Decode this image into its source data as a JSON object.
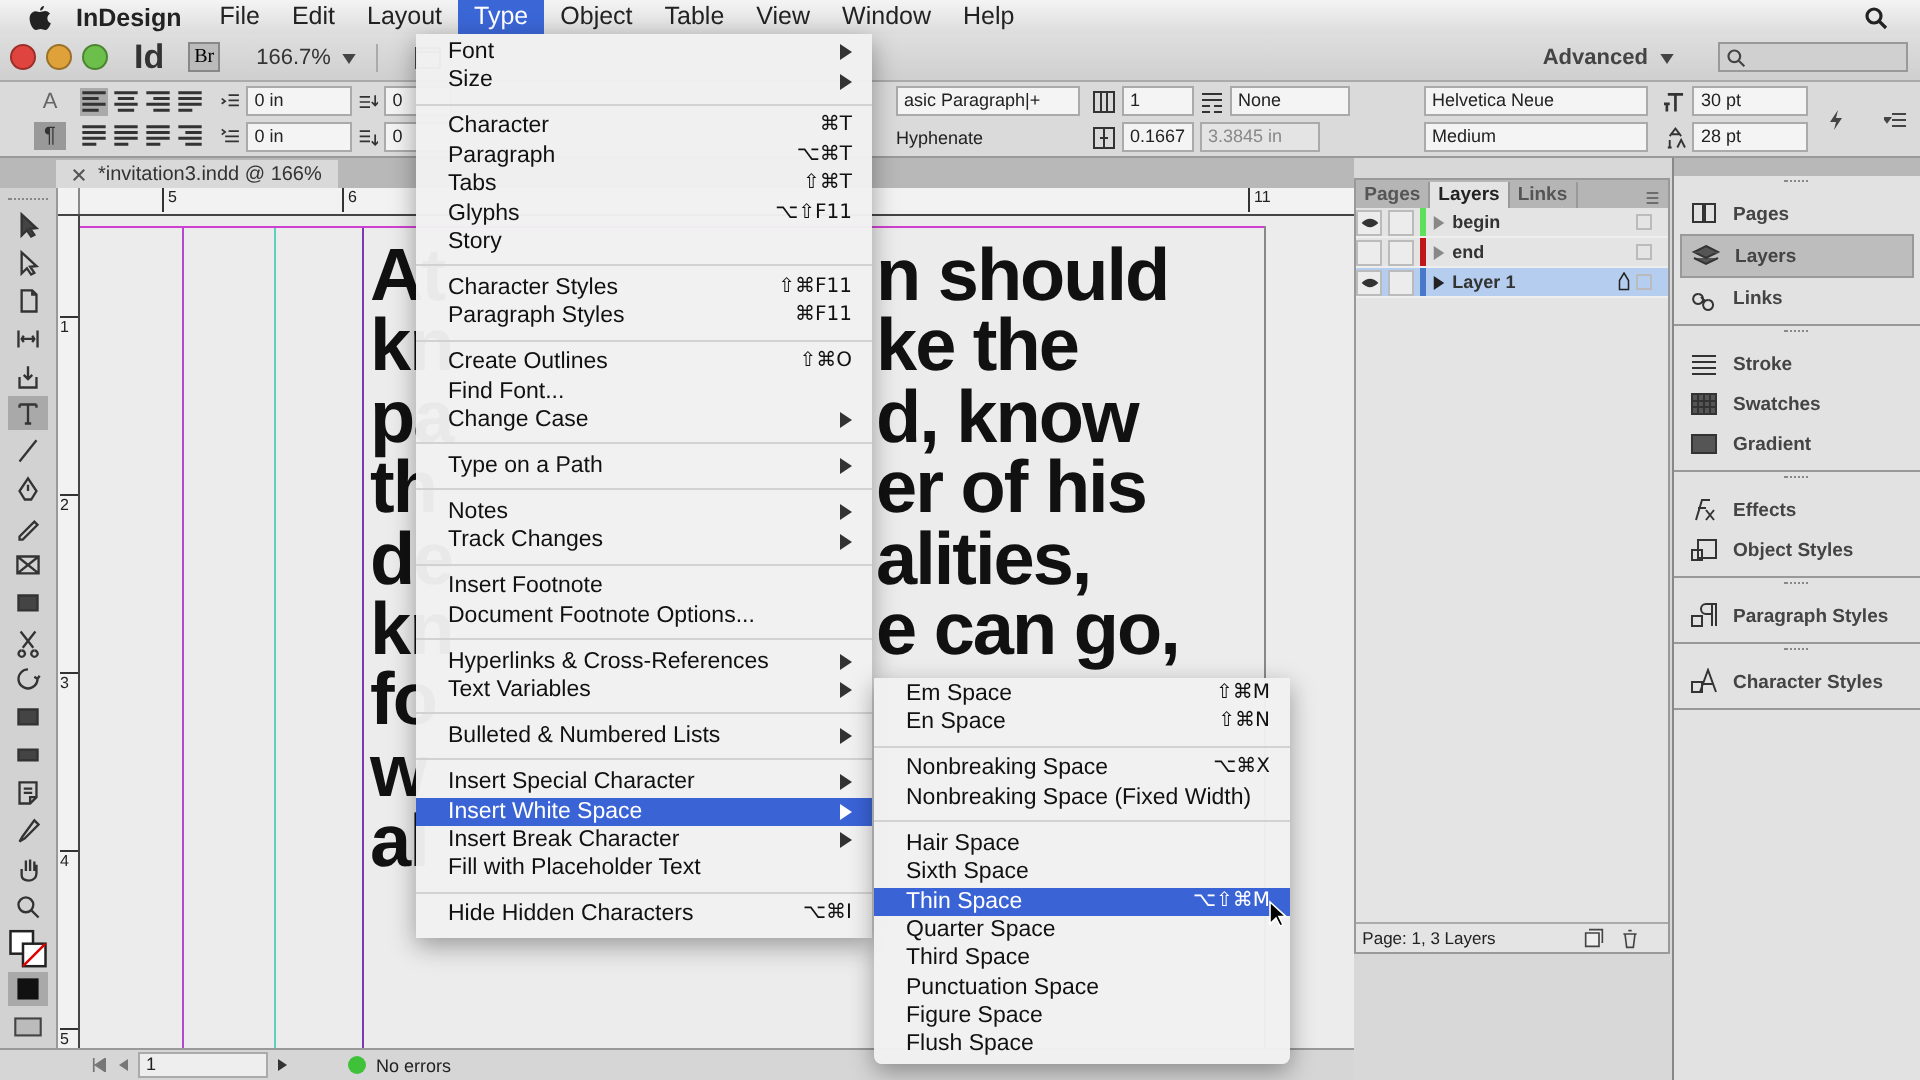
{
  "menu_bar": {
    "app": "InDesign",
    "items": [
      {
        "label": "File",
        "selected": false
      },
      {
        "label": "Edit",
        "selected": false
      },
      {
        "label": "Layout",
        "selected": false
      },
      {
        "label": "Type",
        "selected": true
      },
      {
        "label": "Object",
        "selected": false
      },
      {
        "label": "Table",
        "selected": false
      },
      {
        "label": "View",
        "selected": false
      },
      {
        "label": "Window",
        "selected": false
      },
      {
        "label": "Help",
        "selected": false
      }
    ]
  },
  "app_bar": {
    "logo": "Id",
    "bridge": "Br",
    "zoom": "166.7%",
    "workspace": "Advanced"
  },
  "control_panel": {
    "modes": [
      {
        "label": "A",
        "selected": false
      },
      {
        "label": "¶",
        "selected": true
      }
    ],
    "align": [
      {
        "kind": "left",
        "selected": true
      },
      {
        "kind": "center",
        "selected": false
      },
      {
        "kind": "right",
        "selected": false
      },
      {
        "kind": "justify",
        "selected": false
      },
      {
        "kind": "justify",
        "selected": false
      },
      {
        "kind": "justify",
        "selected": false
      },
      {
        "kind": "justify",
        "selected": false
      },
      {
        "kind": "right",
        "selected": false
      }
    ],
    "left_indent": "0 in",
    "first_indent": "0 in",
    "space_before": "0",
    "space_after": "0",
    "paragraph_style": "asic Paragraph|+",
    "hyphenate": "Hyphenate",
    "columns": "1",
    "span": "None",
    "gutter": "0.1667",
    "width": "3.3845 in",
    "font": "Helvetica Neue",
    "font_style": "Medium",
    "size": "30 pt",
    "leading": "28 pt"
  },
  "document_tab": {
    "title": "*invitation3.indd @ 166%"
  },
  "tools": [
    {
      "kind": "selection",
      "selected": false
    },
    {
      "kind": "direct",
      "selected": false
    },
    {
      "kind": "page",
      "selected": false
    },
    {
      "kind": "gap",
      "selected": false
    },
    {
      "kind": "collector",
      "selected": false
    },
    {
      "kind": "type",
      "selected": true
    },
    {
      "kind": "line",
      "selected": false
    },
    {
      "kind": "pen",
      "selected": false
    },
    {
      "kind": "pencil",
      "selected": false
    },
    {
      "kind": "frame",
      "selected": false
    },
    {
      "kind": "rect",
      "selected": false
    },
    {
      "kind": "scissors",
      "selected": false
    },
    {
      "kind": "transform",
      "selected": false
    },
    {
      "kind": "gradient",
      "selected": false
    },
    {
      "kind": "feather",
      "selected": false
    },
    {
      "kind": "note",
      "selected": false
    },
    {
      "kind": "eyedropper",
      "selected": false
    },
    {
      "kind": "hand",
      "selected": false
    },
    {
      "kind": "zoom",
      "selected": false
    }
  ],
  "rulers": {
    "horizontal": [
      "5",
      "6",
      "11"
    ],
    "vertical": [
      "1",
      "2",
      "3",
      "4",
      "5"
    ]
  },
  "document": {
    "lines": [
      {
        "left": "At",
        "right": "n should"
      },
      {
        "left": "kn",
        "right": "ke the"
      },
      {
        "left": "pa",
        "right": "d, know"
      },
      {
        "left": "th",
        "right": "er of his"
      },
      {
        "left": "de",
        "right": "alities,"
      },
      {
        "left": "kn",
        "right": "e can go,"
      },
      {
        "left": "fo"
      },
      {
        "left": "w"
      },
      {
        "left": "al"
      }
    ]
  },
  "status_bar": {
    "page": "1",
    "preflight": "No errors"
  },
  "type_menu": {
    "groups": [
      [
        {
          "label": "Font",
          "submenu": true,
          "selected": false
        },
        {
          "label": "Size",
          "submenu": true,
          "selected": false
        }
      ],
      [
        {
          "label": "Character",
          "shortcut": "⌘T",
          "selected": false
        },
        {
          "label": "Paragraph",
          "shortcut": "⌥⌘T",
          "selected": false
        },
        {
          "label": "Tabs",
          "shortcut": "⇧⌘T",
          "selected": false
        },
        {
          "label": "Glyphs",
          "shortcut": "⌥⇧F11",
          "selected": false
        },
        {
          "label": "Story",
          "selected": false
        }
      ],
      [
        {
          "label": "Character Styles",
          "shortcut": "⇧⌘F11",
          "selected": false
        },
        {
          "label": "Paragraph Styles",
          "shortcut": "⌘F11",
          "selected": false
        }
      ],
      [
        {
          "label": "Create Outlines",
          "shortcut": "⇧⌘O",
          "selected": false
        },
        {
          "label": "Find Font...",
          "selected": false
        },
        {
          "label": "Change Case",
          "submenu": true,
          "selected": false
        }
      ],
      [
        {
          "label": "Type on a Path",
          "submenu": true,
          "selected": false
        }
      ],
      [
        {
          "label": "Notes",
          "submenu": true,
          "selected": false
        },
        {
          "label": "Track Changes",
          "submenu": true,
          "selected": false
        }
      ],
      [
        {
          "label": "Insert Footnote",
          "selected": false
        },
        {
          "label": "Document Footnote Options...",
          "selected": false
        }
      ],
      [
        {
          "label": "Hyperlinks & Cross-References",
          "submenu": true,
          "selected": false
        },
        {
          "label": "Text Variables",
          "submenu": true,
          "selected": false
        }
      ],
      [
        {
          "label": "Bulleted & Numbered Lists",
          "submenu": true,
          "selected": false
        }
      ],
      [
        {
          "label": "Insert Special Character",
          "submenu": true,
          "selected": false
        },
        {
          "label": "Insert White Space",
          "submenu": true,
          "selected": true
        },
        {
          "label": "Insert Break Character",
          "submenu": true,
          "selected": false
        },
        {
          "label": "Fill with Placeholder Text",
          "selected": false
        }
      ],
      [
        {
          "label": "Hide Hidden Characters",
          "shortcut": "⌥⌘I",
          "selected": false
        }
      ]
    ]
  },
  "white_space_menu": {
    "groups": [
      [
        {
          "label": "Em Space",
          "shortcut": "⇧⌘M",
          "selected": false
        },
        {
          "label": "En Space",
          "shortcut": "⇧⌘N",
          "selected": false
        }
      ],
      [
        {
          "label": "Nonbreaking Space",
          "shortcut": "⌥⌘X",
          "selected": false
        },
        {
          "label": "Nonbreaking Space (Fixed Width)",
          "selected": false
        }
      ],
      [
        {
          "label": "Hair Space",
          "selected": false
        },
        {
          "label": "Sixth Space",
          "selected": false
        },
        {
          "label": "Thin Space",
          "shortcut": "⌥⇧⌘M",
          "selected": true
        },
        {
          "label": "Quarter Space",
          "selected": false
        },
        {
          "label": "Third Space",
          "selected": false
        },
        {
          "label": "Punctuation Space",
          "selected": false
        },
        {
          "label": "Figure Space",
          "selected": false
        },
        {
          "label": "Flush Space",
          "selected": false
        }
      ]
    ]
  },
  "layers_panel": {
    "tabs": [
      {
        "label": "Pages",
        "selected": false
      },
      {
        "label": "Layers",
        "selected": true
      },
      {
        "label": "Links",
        "selected": false
      }
    ],
    "layers": [
      {
        "name": "begin",
        "color": "#5fe05a",
        "visible": true,
        "selected": false
      },
      {
        "name": "end",
        "color": "#c0161b",
        "visible": false,
        "selected": false
      },
      {
        "name": "Layer 1",
        "color": "#4a78c8",
        "visible": true,
        "selected": true
      }
    ],
    "footer": "Page: 1, 3 Layers"
  },
  "dock": {
    "groups": [
      [
        {
          "label": "Pages",
          "kind": "pages",
          "selected": false
        },
        {
          "label": "Layers",
          "kind": "layers",
          "selected": true
        },
        {
          "label": "Links",
          "kind": "links",
          "selected": false
        }
      ],
      [
        {
          "label": "Stroke",
          "kind": "stroke",
          "selected": false
        },
        {
          "label": "Swatches",
          "kind": "swatches",
          "selected": false
        },
        {
          "label": "Gradient",
          "kind": "gradient",
          "selected": false
        }
      ],
      [
        {
          "label": "Effects",
          "kind": "effects",
          "selected": false
        },
        {
          "label": "Object Styles",
          "kind": "object-styles",
          "selected": false
        }
      ],
      [
        {
          "label": "Paragraph Styles",
          "kind": "paragraph-styles",
          "selected": false
        }
      ],
      [
        {
          "label": "Character Styles",
          "kind": "character-styles",
          "selected": false
        }
      ]
    ]
  }
}
